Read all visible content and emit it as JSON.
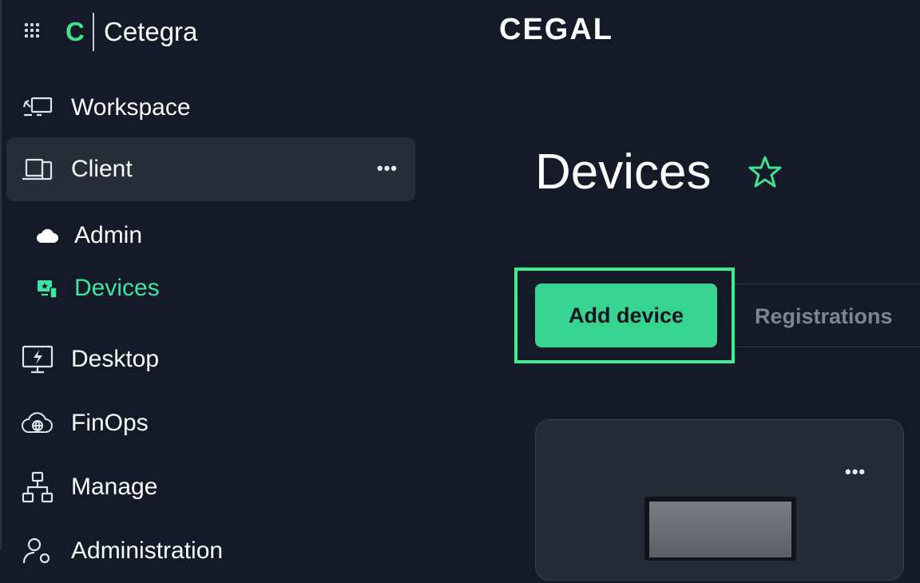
{
  "app": {
    "brand_letter": "C",
    "brand_name": "Cetegra",
    "company_logo_text": "CEGAL"
  },
  "sidebar": {
    "items": [
      {
        "label": "Workspace",
        "icon": "workspace-icon"
      },
      {
        "label": "Client",
        "icon": "client-devices-icon",
        "active": true
      },
      {
        "label": "Desktop",
        "icon": "desktop-icon"
      },
      {
        "label": "FinOps",
        "icon": "cloud-globe-icon"
      },
      {
        "label": "Manage",
        "icon": "network-icon"
      },
      {
        "label": "Administration",
        "icon": "admin-icon"
      }
    ],
    "client_more": "•••",
    "client_sub": [
      {
        "label": "Admin",
        "icon": "cloud-icon"
      },
      {
        "label": "Devices",
        "icon": "devices-star-icon",
        "active": true
      }
    ]
  },
  "main": {
    "title": "Devices",
    "add_button": "Add device",
    "tabs": [
      "Registrations"
    ],
    "card_more": "•••"
  },
  "colors": {
    "background": "#141a27",
    "accent": "#3ee48e",
    "button": "#36d490",
    "active_item": "#272d38"
  }
}
